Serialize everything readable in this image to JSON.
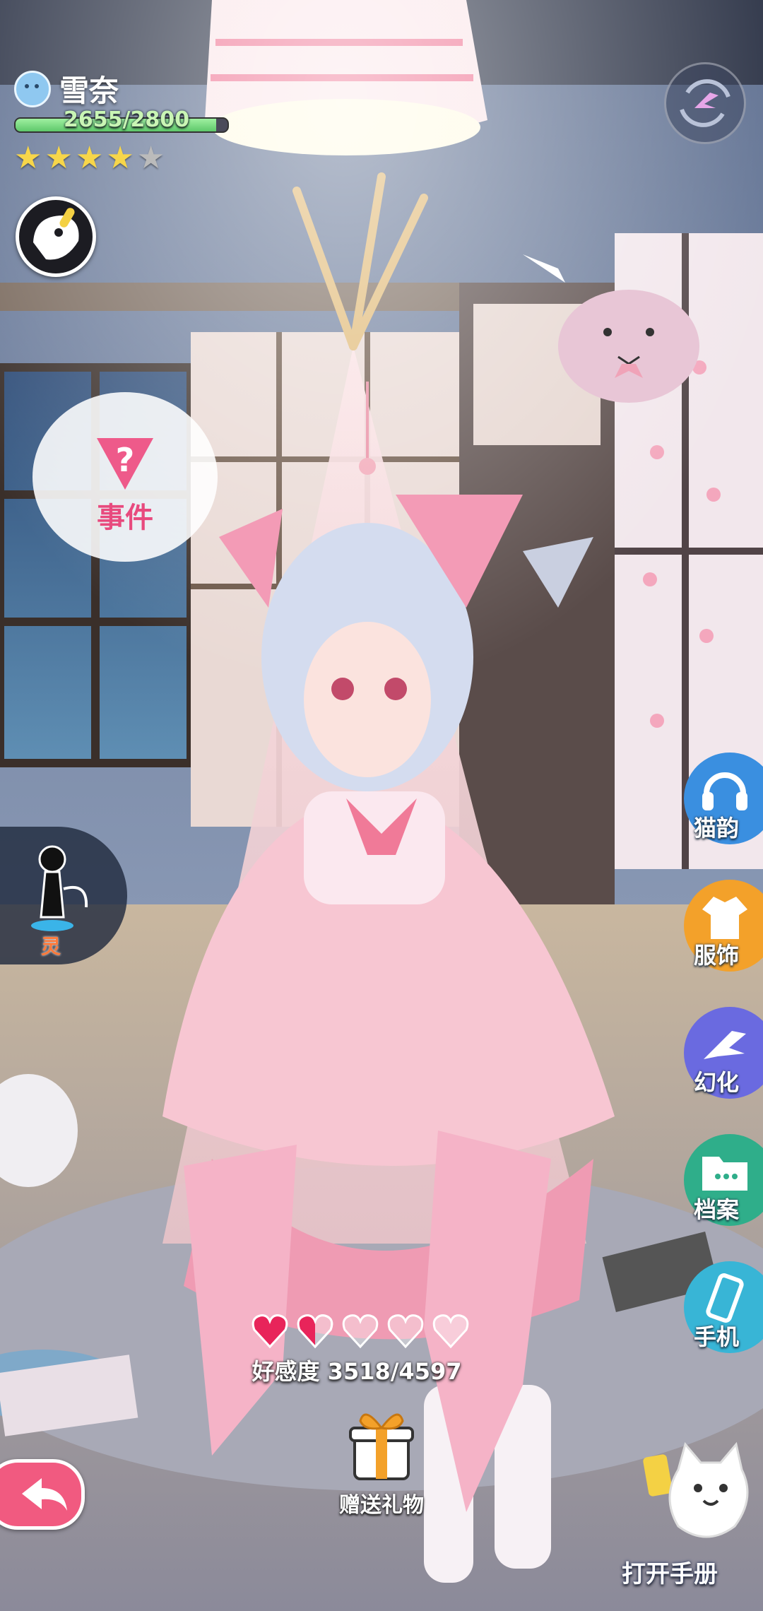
{
  "character": {
    "name": "雪奈",
    "hp_text": "2655/2800",
    "hp_fraction": 0.9482,
    "stars_filled": 4,
    "stars_total": 5
  },
  "event_bubble": {
    "label": "事件"
  },
  "spirit_tab": {
    "label": "灵"
  },
  "side_menu": {
    "items": [
      {
        "label": "猫韵",
        "icon": "headphones-icon",
        "color": "#3a8fe0"
      },
      {
        "label": "服饰",
        "icon": "clothing-icon",
        "color": "#f3a12a"
      },
      {
        "label": "幻化",
        "icon": "bird-transform-icon",
        "color": "#6a6ae0"
      },
      {
        "label": "档案",
        "icon": "folder-icon",
        "color": "#2fae8a"
      },
      {
        "label": "手机",
        "icon": "phone-icon",
        "color": "#38b5d6"
      }
    ]
  },
  "affection": {
    "label": "好感度",
    "value_text": "3518/4597",
    "hearts_filled": 1.5,
    "hearts_total": 5
  },
  "gift": {
    "label": "赠送礼物"
  },
  "handbook": {
    "label": "打开手册"
  },
  "colors": {
    "accent_pink": "#f15a80",
    "hp_green": "#5ec86a",
    "star_gold": "#f7d64a"
  }
}
